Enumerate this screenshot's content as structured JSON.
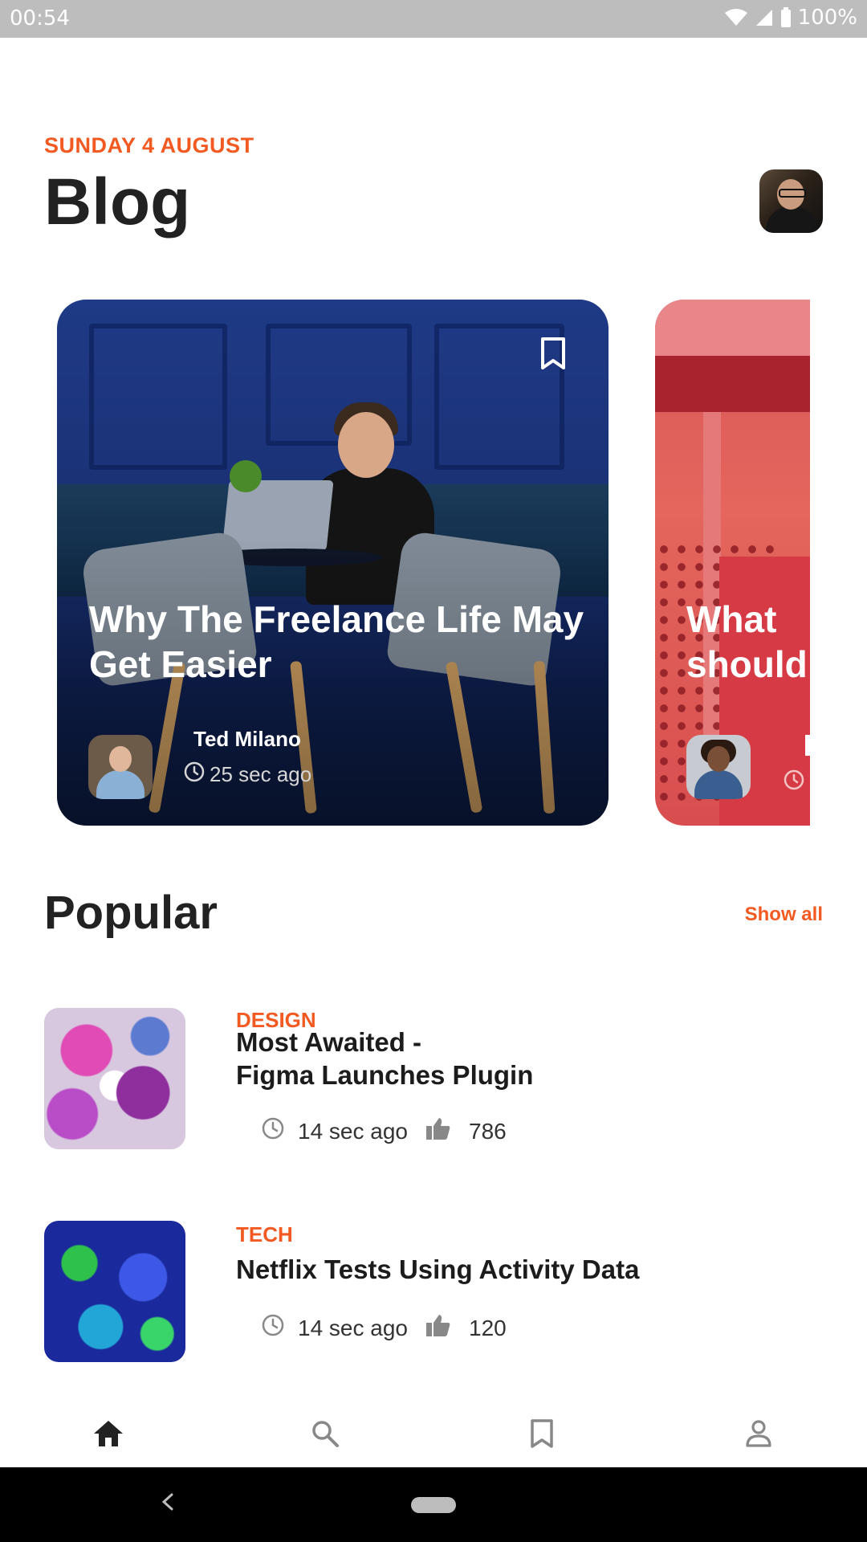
{
  "status_bar": {
    "time": "00:54",
    "battery": "100%"
  },
  "header": {
    "date": "SUNDAY 4 AUGUST",
    "title": "Blog"
  },
  "featured": [
    {
      "title": "Why The Freelance Life May Get Easier",
      "author": "Ted Milano",
      "time": "25 sec ago"
    },
    {
      "title_line1": "What",
      "title_line2": "should"
    }
  ],
  "popular": {
    "title": "Popular",
    "show_all": "Show all",
    "items": [
      {
        "category": "DESIGN",
        "title_line1": "Most Awaited -",
        "title_line2": "Figma Launches Plugin",
        "time": "14 sec ago",
        "likes": "786"
      },
      {
        "category": "TECH",
        "title_line1": "Netflix Tests Using Activity Data",
        "time": "14 sec ago",
        "likes": "120"
      }
    ]
  },
  "colors": {
    "accent": "#f25a22",
    "text": "#1c1c1c",
    "status_bar": "#bdbdbd"
  },
  "icons": {
    "nav": [
      "home-icon",
      "search-icon",
      "bookmark-icon",
      "profile-icon"
    ],
    "meta": [
      "clock-icon",
      "thumbs-up-icon"
    ]
  }
}
